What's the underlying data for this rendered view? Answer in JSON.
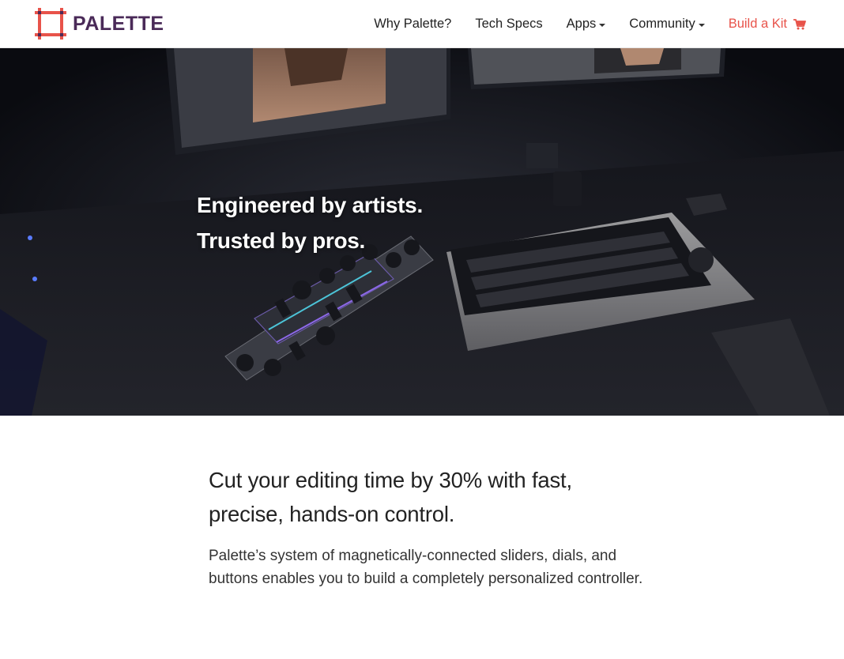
{
  "brand": {
    "name": "PALETTE",
    "logo_icon": "square-frame-icon",
    "colors": {
      "frame": "#e8534a",
      "text": "#4a2a58"
    }
  },
  "nav": {
    "items": [
      {
        "label": "Why Palette?",
        "dropdown": false
      },
      {
        "label": "Tech Specs",
        "dropdown": false
      },
      {
        "label": "Apps",
        "dropdown": true
      },
      {
        "label": "Community",
        "dropdown": true
      }
    ],
    "cta": {
      "label": "Build a Kit",
      "icon": "shopping-cart-icon",
      "color": "#e8534a"
    }
  },
  "hero": {
    "line1": "Engineered by artists.",
    "line2": "Trusted by pros."
  },
  "main": {
    "headline": "Cut your editing time by 30% with fast, precise, hands-on control.",
    "body": "Palette’s system of magnetically-connected sliders, dials, and buttons enables you to build a completely personalized controller."
  }
}
